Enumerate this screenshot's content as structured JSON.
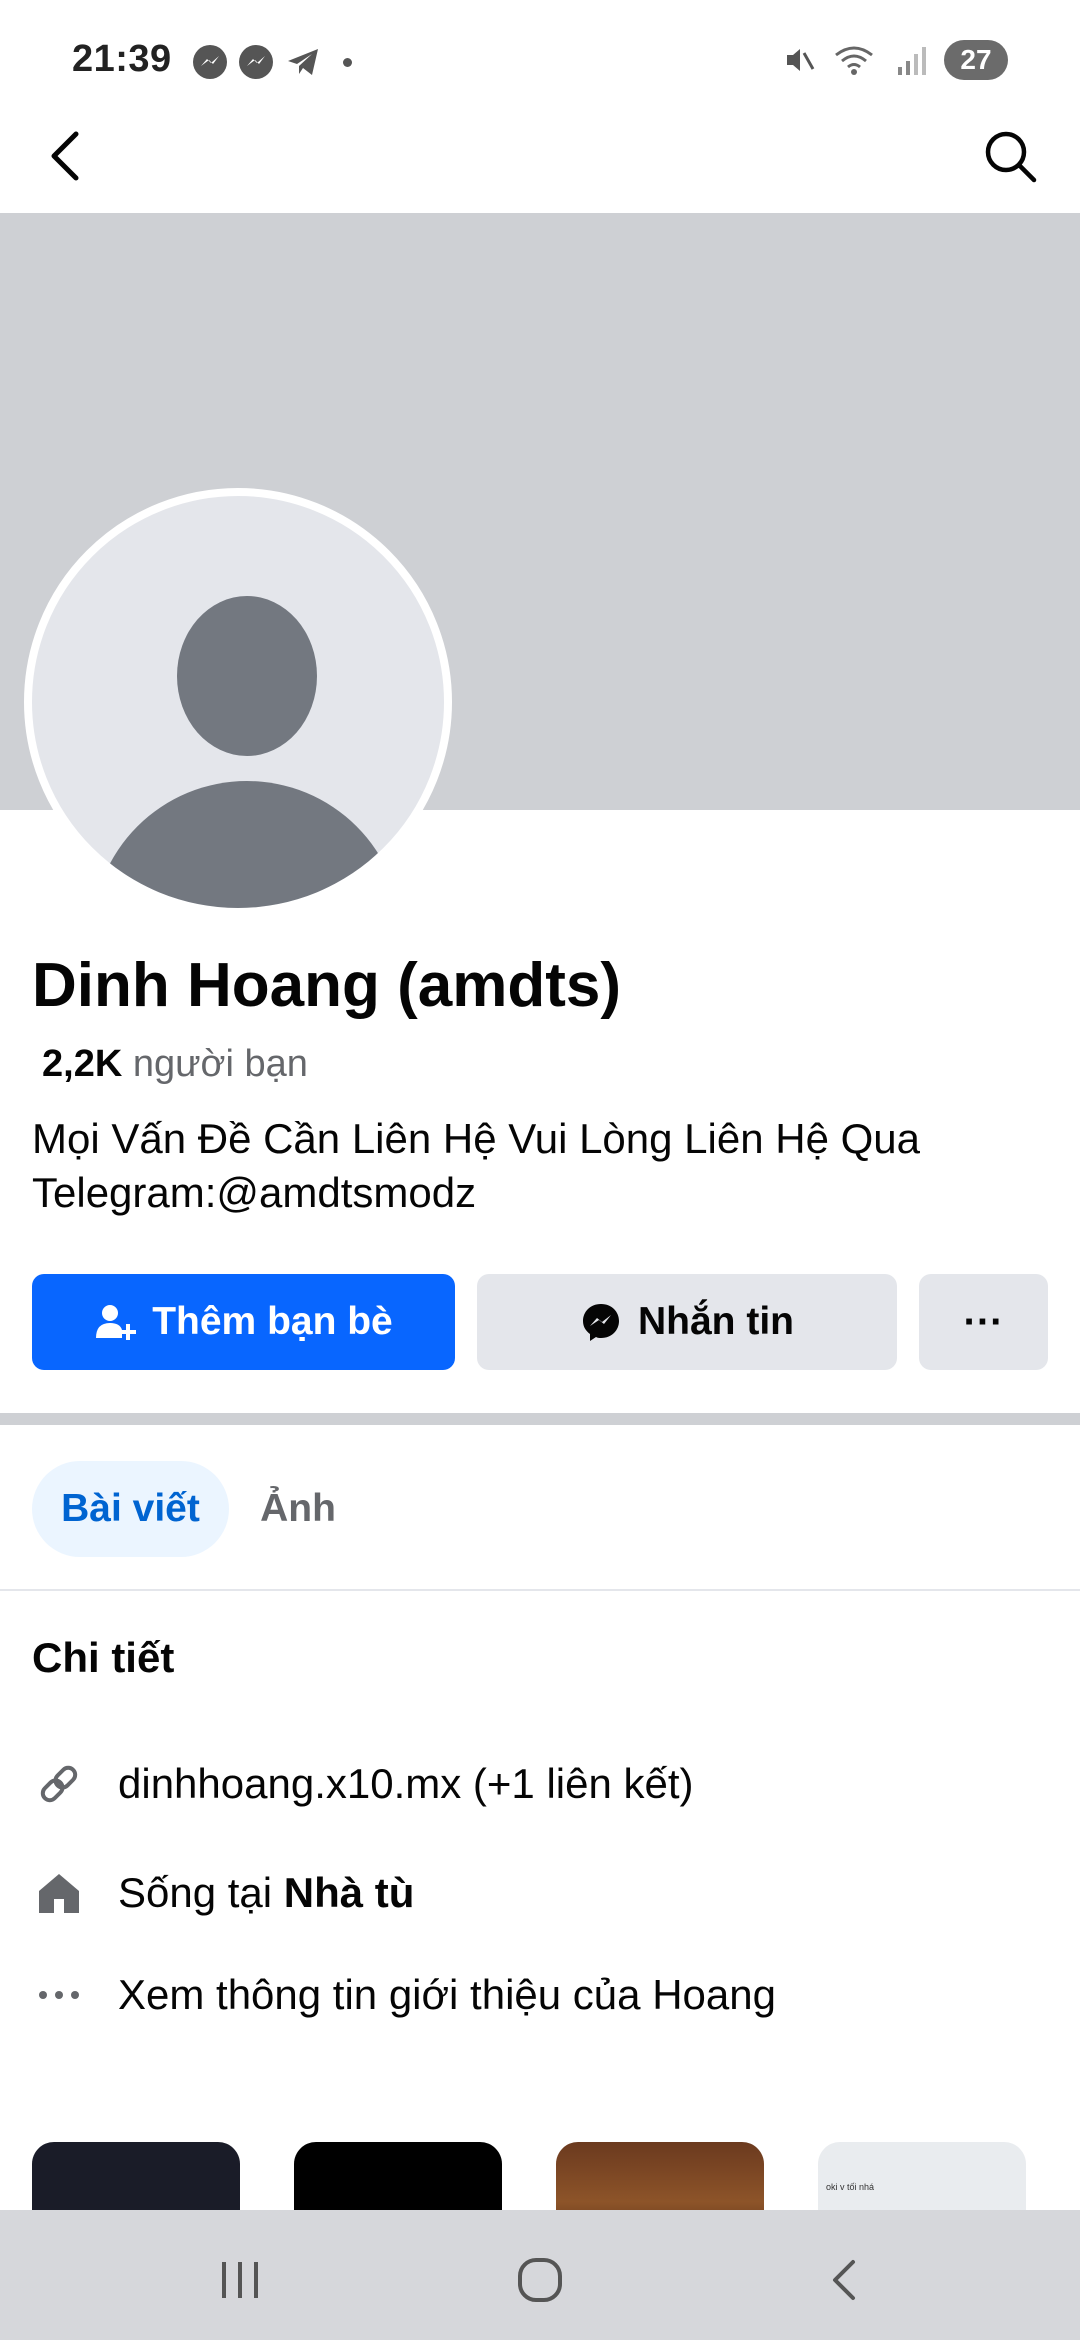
{
  "status_bar": {
    "time": "21:39",
    "battery": "27"
  },
  "profile": {
    "name": "Dinh Hoang (amdts)",
    "friends_count": "2,2K",
    "friends_label": "người bạn",
    "bio": "Mọi Vấn Đề Cần Liên Hệ Vui Lòng Liên Hệ Qua Telegram:@amdtsmodz"
  },
  "actions": {
    "add_friend": "Thêm bạn bè",
    "message": "Nhắn tin",
    "more": "···"
  },
  "tabs": [
    {
      "label": "Bài viết",
      "active": true
    },
    {
      "label": "Ảnh",
      "active": false
    }
  ],
  "details": {
    "title": "Chi tiết",
    "link": "dinhhoang.x10.mx (+1 liên kết)",
    "lives_prefix": "Sống tại ",
    "lives_place": "Nhà tù",
    "see_about": "Xem thông tin giới thiệu của Hoang"
  },
  "thumb_text": "oki v tối nhá",
  "colors": {
    "primary": "#0866ff",
    "cover": "#ced0d4",
    "button_gray": "#e4e6eb",
    "tab_active_bg": "#ebf5ff"
  }
}
